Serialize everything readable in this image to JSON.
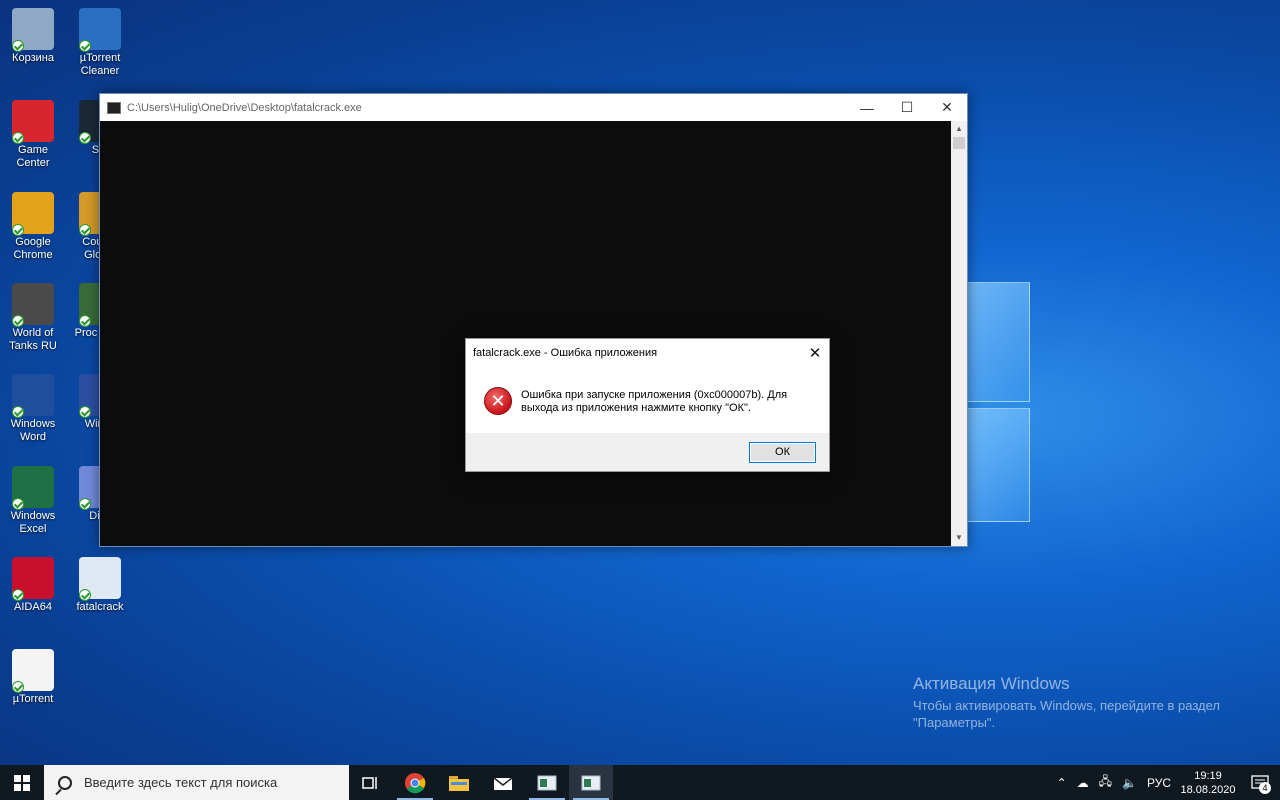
{
  "desktop": {
    "icons_col1": [
      {
        "label": "Корзина",
        "name": "recycle-bin-icon",
        "color": "#8fa9c4"
      },
      {
        "label": "Game Center",
        "name": "game-center-icon",
        "color": "#d9262c"
      },
      {
        "label": "Google Chrome",
        "name": "google-chrome-icon",
        "color": "#e3a21a"
      },
      {
        "label": "World of Tanks RU",
        "name": "world-of-tanks-icon",
        "color": "#4a4a4a"
      },
      {
        "label": "Windows Word",
        "name": "word-icon",
        "color": "#1f4e9c"
      },
      {
        "label": "Windows Excel",
        "name": "excel-icon",
        "color": "#1d7145"
      },
      {
        "label": "AIDA64",
        "name": "aida64-icon",
        "color": "#c8102e"
      },
      {
        "label": "µTorrent",
        "name": "utorrent-file-icon",
        "color": "#f4f4f4"
      }
    ],
    "icons_col2": [
      {
        "label": "µTorrent Cleaner",
        "name": "utorrent-cleaner-icon",
        "color": "#2a6fc0"
      },
      {
        "label": "Ste",
        "name": "steam-icon",
        "color": "#1b2838"
      },
      {
        "label": "Counte Global",
        "name": "counter-strike-icon",
        "color": "#d49a2a"
      },
      {
        "label": "Proc Hack",
        "name": "process-hacker-icon",
        "color": "#3a6a3a"
      },
      {
        "label": "Winds",
        "name": "winds-icon",
        "color": "#2b4fa0"
      },
      {
        "label": "Disc",
        "name": "discord-icon",
        "color": "#7289da"
      },
      {
        "label": "fatalcrack",
        "name": "fatalcrack-icon",
        "color": "#dfe9f5"
      }
    ]
  },
  "console": {
    "title": "C:\\Users\\Hulig\\OneDrive\\Desktop\\fatalcrack.exe",
    "minimize": "—",
    "maximize": "☐",
    "close": "✕"
  },
  "dialog": {
    "title": "fatalcrack.exe - Ошибка приложения",
    "close": "✕",
    "message": "Ошибка при запуске приложения (0xc000007b). Для выхода из приложения нажмите кнопку \"ОК\".",
    "ok_label": "ОК",
    "icon_glyph": "✕"
  },
  "activation": {
    "line1": "Активация Windows",
    "line2": "Чтобы активировать Windows, перейдите в раздел",
    "line3": "\"Параметры\"."
  },
  "taskbar": {
    "search_placeholder": "Введите здесь текст для поиска",
    "lang": "РУС",
    "time": "19:19",
    "date": "18.08.2020",
    "notifications": "4"
  }
}
